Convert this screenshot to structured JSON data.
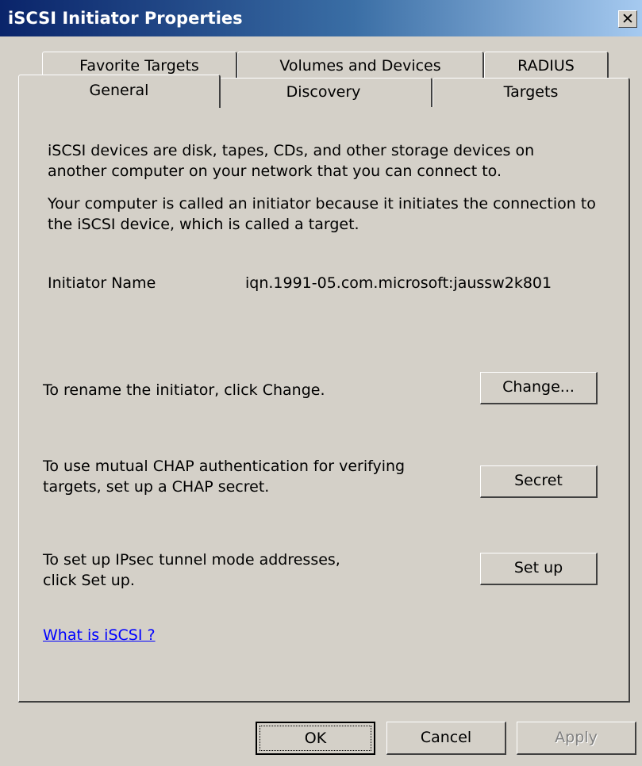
{
  "window": {
    "title": "iSCSI Initiator Properties",
    "close_glyph": "✕"
  },
  "tabs_back": [
    "Favorite Targets",
    "Volumes and Devices",
    "RADIUS"
  ],
  "tabs_front": [
    "General",
    "Discovery",
    "Targets"
  ],
  "general": {
    "intro_line1": "iSCSI devices are disk, tapes, CDs, and other storage devices on",
    "intro_line2": "another computer on your network that you can connect to.",
    "initiator_line1": "Your computer is called an initiator because it initiates the connection to",
    "initiator_line2": "the iSCSI device, which is called a target.",
    "initiator_name_label": "Initiator Name",
    "initiator_name_value": "iqn.1991-05.com.microsoft:jaussw2k801",
    "rename_text": "To rename the initiator, click Change.",
    "change_label": "Change...",
    "chap_line1": "To use mutual CHAP authentication for verifying",
    "chap_line2": "targets, set up a CHAP secret.",
    "secret_label": "Secret",
    "ipsec_line1": "To set up IPsec tunnel mode addresses,",
    "ipsec_line2": "click Set up.",
    "setup_label": "Set up",
    "what_is_link": "What is iSCSI ?"
  },
  "buttons": {
    "ok": "OK",
    "cancel": "Cancel",
    "apply": "Apply"
  }
}
